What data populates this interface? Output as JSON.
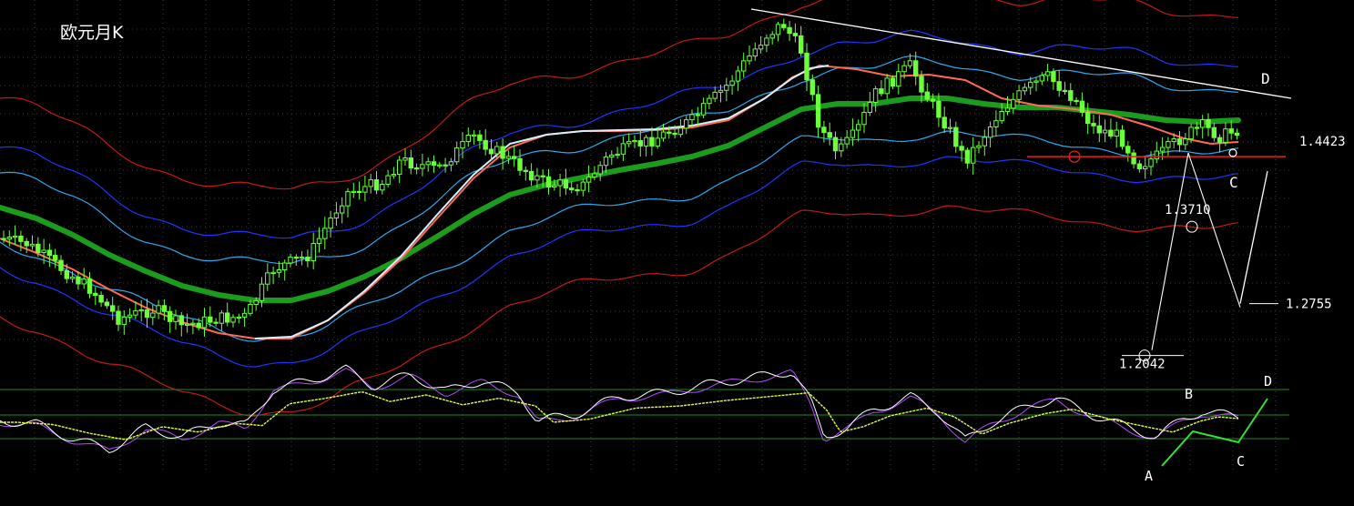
{
  "chart_data": {
    "type": "candlestick",
    "title": "欧元月K",
    "y_range": [
      1.05,
      1.62
    ],
    "price_labels": [
      "1.4423",
      "1.3710",
      "1.2755",
      "1.2042"
    ],
    "price_values": [
      1.4423,
      1.371,
      1.2755,
      1.2042
    ],
    "wedge_labels": [
      "D",
      "C"
    ],
    "oscillator_labels": [
      "A",
      "B",
      "C",
      "D"
    ],
    "colors": {
      "background": "#000000",
      "grid": "#3a3a3a",
      "candle": "#6cff3c",
      "ma_thick": "#1c9c1c",
      "ma_red": "#ff6a55",
      "ma_white": "#d8f0ff",
      "band_outer": "#c41818",
      "band_mid": "#2233ff",
      "band_inner": "#2aaaee",
      "trendline": "#ffffff",
      "level_line": "#e62020",
      "osc_fast": "#ffffff",
      "osc_slow": "#e0ff3c",
      "osc_wave": "#33e033"
    }
  }
}
